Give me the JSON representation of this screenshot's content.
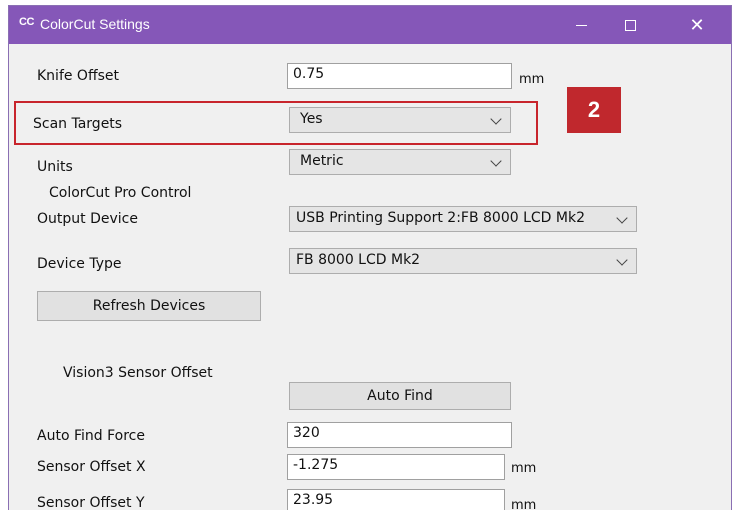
{
  "window": {
    "app_icon": "CC",
    "title": "ColorCut Settings",
    "close_glyph": "✕"
  },
  "fields": {
    "knife_offset": {
      "label": "Knife Offset",
      "value": "0.75",
      "unit": "mm"
    },
    "scan_targets": {
      "label": "Scan Targets",
      "value": "Yes"
    },
    "units": {
      "label": "Units",
      "value": "Metric"
    },
    "section_colorcut_pro": "ColorCut Pro Control",
    "output_device": {
      "label": "Output Device",
      "value": "USB Printing Support 2:FB 8000 LCD Mk2"
    },
    "device_type": {
      "label": "Device Type",
      "value": "FB 8000 LCD Mk2"
    },
    "refresh_devices": "Refresh Devices",
    "section_vision3": "Vision3 Sensor Offset",
    "auto_find": "Auto Find",
    "auto_find_force": {
      "label": "Auto Find Force",
      "value": "320"
    },
    "sensor_offset_x": {
      "label": "Sensor Offset X",
      "value": "-1.275",
      "unit": "mm"
    },
    "sensor_offset_y": {
      "label": "Sensor Offset Y",
      "value": "23.95",
      "unit": "mm"
    }
  },
  "annotation": {
    "callout_number": "2",
    "color": "#c0282d"
  },
  "colors": {
    "titlebar": "#8557b8"
  }
}
